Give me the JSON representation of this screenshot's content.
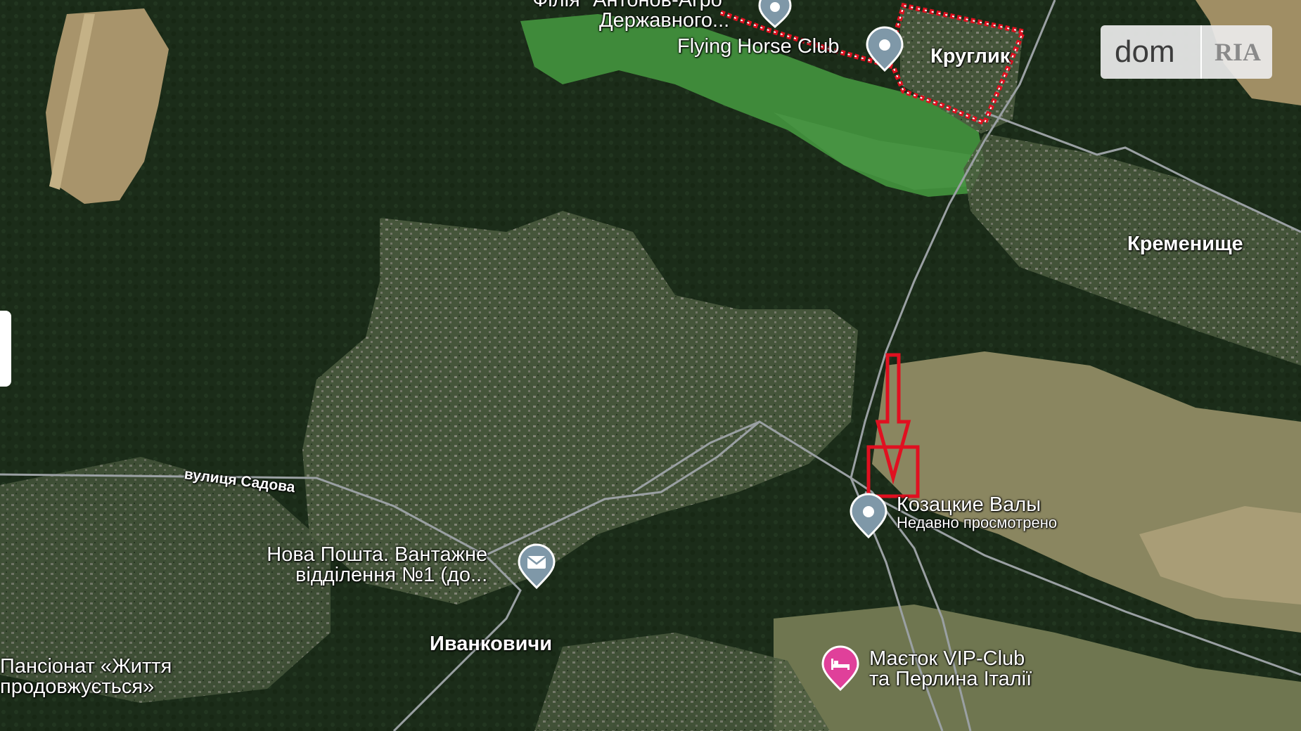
{
  "map": {
    "labels": {
      "flying_horse": "Flying Horse Club",
      "filia_line1": "Філія \"Антонов-Агро\"",
      "filia_line2": "Державного...",
      "kruglik": "Круглик",
      "kremenishche": "Кременище",
      "street_sadova": "вулиця Садова",
      "kozatskie_valy": "Козацкие Валы",
      "recently_viewed": "Недавно просмотрено",
      "nova_poshta_line1": "Нова Пошта. Вантажне",
      "nova_poshta_line2": "відділення №1 (до...",
      "ivankovychi": "Иванковичи",
      "pansionat_line1": "Пансіонат «Життя",
      "pansionat_line2": "продовжується»",
      "maetok_line1": "Маєток VIP-Club",
      "maetok_line2": "та Перлина Італії"
    },
    "icons": {
      "pin": "map-pin-icon",
      "mail": "mail-icon",
      "hotel": "hotel-bed-icon",
      "arrow": "red-arrow-marker"
    },
    "colors": {
      "pin": "#7f98a8",
      "pin_hotel": "#e0409a",
      "marker_red": "#e01020",
      "boundary_red": "#e01020",
      "road": "#9aa0a3",
      "forest": "#1c2e1a",
      "lake": "#3f8a3a",
      "field": "#9b8b62"
    }
  },
  "logo": {
    "dom": "dom",
    "ria": "RIA"
  }
}
